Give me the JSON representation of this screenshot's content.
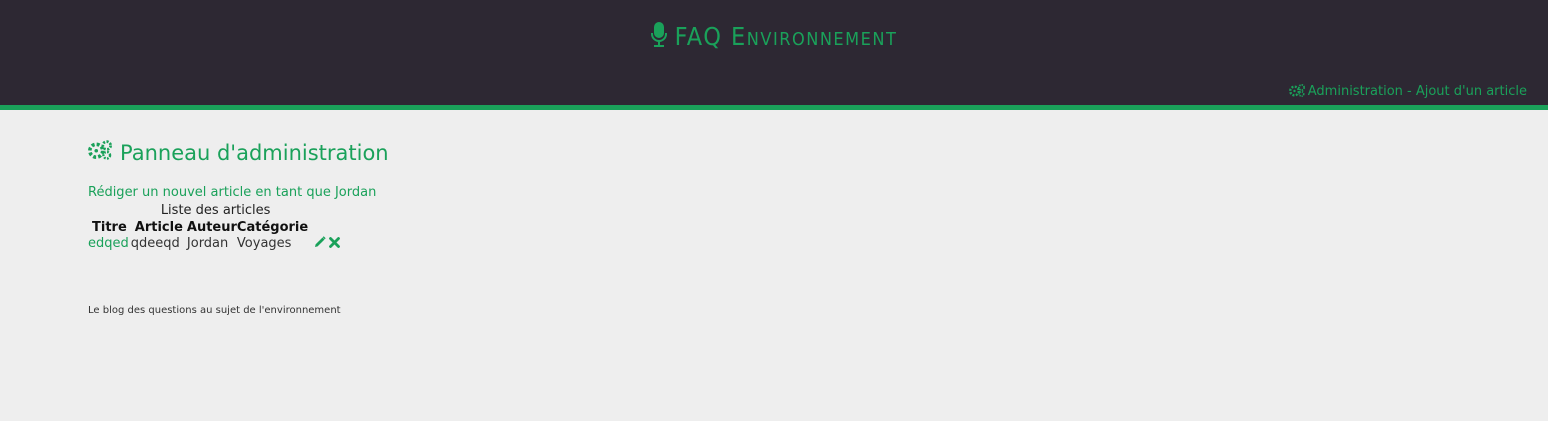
{
  "header": {
    "brand": "FAQ Environnement",
    "admin_link": "Administration - Ajout d'un article"
  },
  "main": {
    "panel_title": "Panneau d'administration",
    "write_link": "Rédiger un nouvel article en tant que Jordan",
    "table": {
      "caption": "Liste des articles",
      "columns": [
        "Titre",
        "Article",
        "Auteur",
        "Catégorie"
      ],
      "rows": [
        {
          "title": "edqed",
          "article": "qdeeqd",
          "author": "Jordan",
          "category": "Voyages"
        }
      ]
    }
  },
  "footer": {
    "text": "Le blog des questions au sujet de l'environnement"
  },
  "colors": {
    "accent": "#1aa15a",
    "header_bg": "#2d2833",
    "page_bg": "#eeeeee"
  },
  "icons": {
    "brand": "microphone-icon",
    "admin": "gears-icon",
    "edit": "pencil-icon",
    "delete": "close-icon"
  }
}
